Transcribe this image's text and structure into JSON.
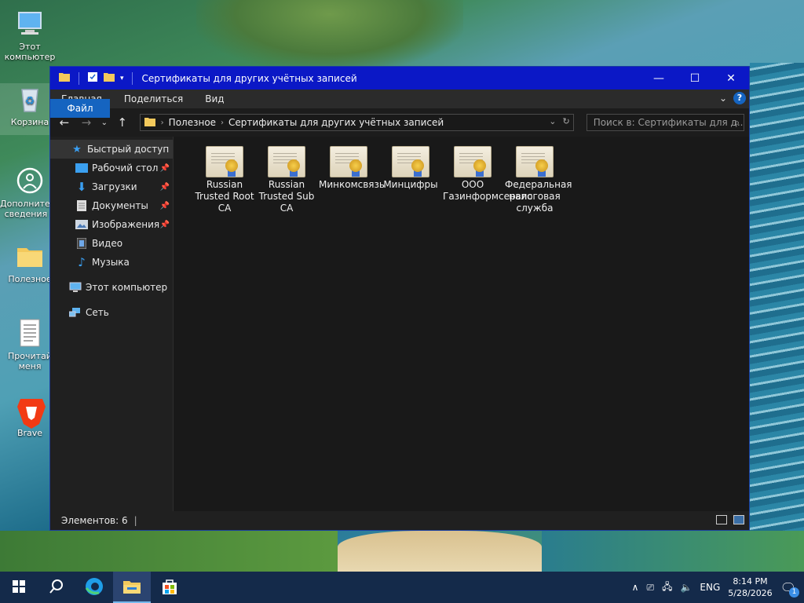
{
  "desktop": {
    "icons": [
      {
        "label": "Этот компьютер"
      },
      {
        "label": "Корзина"
      },
      {
        "label": "Дополнительные сведения о"
      },
      {
        "label": "Полезное"
      },
      {
        "label": "Прочитай меня"
      },
      {
        "label": "Brave"
      }
    ]
  },
  "window": {
    "title": "Сертификаты для других учётных записей",
    "ribbon": {
      "tabs": [
        {
          "label": "Файл"
        },
        {
          "label": "Главная"
        },
        {
          "label": "Поделиться"
        },
        {
          "label": "Вид"
        }
      ],
      "help": "?"
    },
    "address": {
      "crumbs": [
        "Полезное",
        "Сертификаты для других учётных записей"
      ]
    },
    "search": {
      "placeholder": "Поиск в: Сертификаты для д..."
    },
    "nav": {
      "quick_access": "Быстрый доступ",
      "items": [
        {
          "label": "Рабочий стол",
          "pinned": true
        },
        {
          "label": "Загрузки",
          "pinned": true
        },
        {
          "label": "Документы",
          "pinned": true
        },
        {
          "label": "Изображения",
          "pinned": true
        },
        {
          "label": "Видео",
          "pinned": false
        },
        {
          "label": "Музыка",
          "pinned": false
        }
      ],
      "this_pc": "Этот компьютер",
      "network": "Сеть"
    },
    "files": [
      {
        "name": "Russian Trusted Root CA"
      },
      {
        "name": "Russian Trusted Sub CA"
      },
      {
        "name": "Минкомсвязь"
      },
      {
        "name": "Минцифры"
      },
      {
        "name": "ООО Газинформсервис"
      },
      {
        "name": "Федеральная налоговая служба"
      }
    ],
    "status": "Элементов: 6"
  },
  "taskbar": {
    "lang": "ENG",
    "time": "8:14 PM",
    "date": "5/28/2026",
    "notifications": "1"
  },
  "colors": {
    "titlebar": "#0b18c6",
    "file_tab": "#1564c0",
    "taskbar": "#142a4a"
  }
}
